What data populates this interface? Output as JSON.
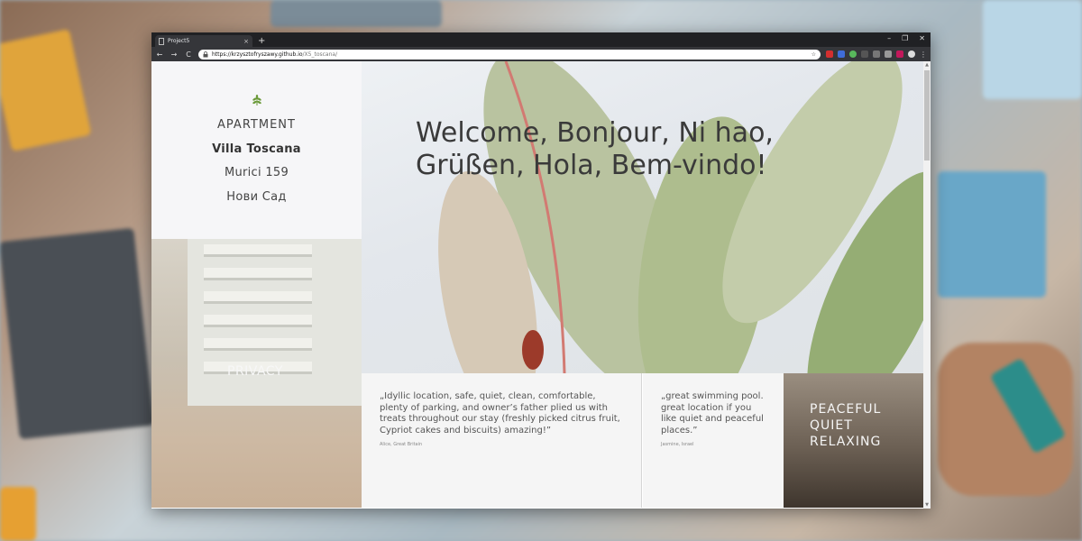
{
  "browser": {
    "tab_title": "Project5",
    "tab_close": "×",
    "new_tab": "+",
    "window_controls": [
      "–",
      "❐",
      "✕"
    ],
    "nav": {
      "back": "←",
      "forward": "→",
      "reload": "C"
    },
    "url_host": "https://krzysztofryszawy.github.io",
    "url_path": "/X5_toscana/",
    "star": "☆",
    "menu": "⋮"
  },
  "sidebar": {
    "line1": "APARTMENT",
    "line2": "Villa Toscana",
    "line3": "Murici 159",
    "line4": "Нови Сад"
  },
  "privacy": {
    "label": "PRIVACY"
  },
  "hero": {
    "line1": "Welcome, Bonjour, Ni hao,",
    "line2": "Grüßen, Hola, Bem-vindo!"
  },
  "reviews": [
    {
      "quote": "„Idyllic location, safe, quiet, clean, comfortable, plenty of parking, and owner’s father plied us with treats throughout our stay (freshly picked citrus fruit, Cypriot cakes and biscuits) amazing!”",
      "author": "Alice, Great Britain"
    },
    {
      "quote": "„great swimming pool. great location if you like quiet and peaceful places.”",
      "author": "Jasmine, Israel"
    }
  ],
  "feature": {
    "line1": "PEACEFUL",
    "line2": "QUIET",
    "line3": "RELAXING"
  },
  "colors": {
    "leaf_green": "#6b9a3a",
    "text_dark": "#3a3a3a",
    "panel_bg": "#f6f6f8"
  }
}
